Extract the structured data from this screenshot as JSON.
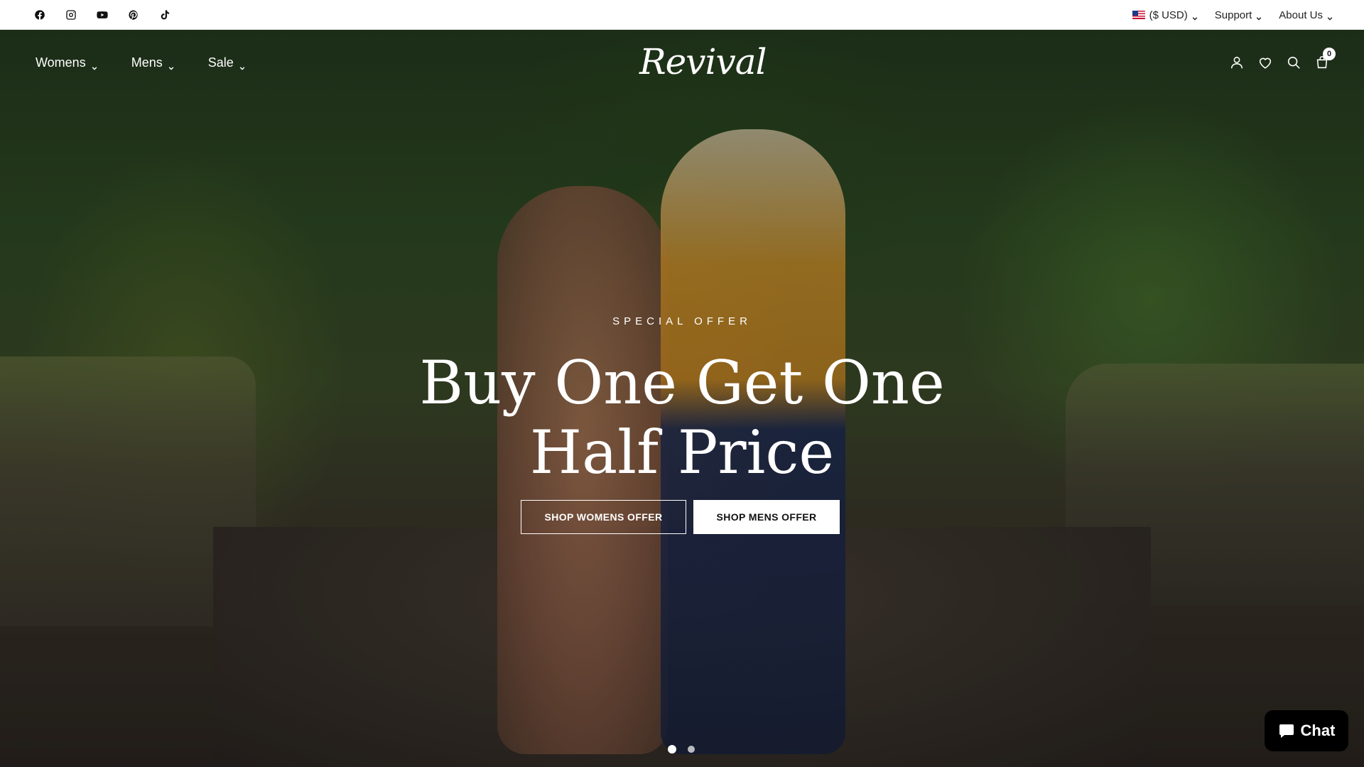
{
  "topbar": {
    "social": [
      {
        "name": "facebook-icon"
      },
      {
        "name": "instagram-icon"
      },
      {
        "name": "youtube-icon"
      },
      {
        "name": "pinterest-icon"
      },
      {
        "name": "tiktok-icon"
      }
    ],
    "currency_label": "($ USD)",
    "support_label": "Support",
    "about_label": "About Us"
  },
  "nav": {
    "items": [
      {
        "label": "Womens"
      },
      {
        "label": "Mens"
      },
      {
        "label": "Sale"
      }
    ],
    "logo_text": "Revival",
    "cart_count": "0"
  },
  "hero": {
    "eyebrow": "SPECIAL OFFER",
    "headline_line1": "Buy One Get One",
    "headline_line2": "Half Price",
    "cta_womens": "SHOP WOMENS OFFER",
    "cta_mens": "SHOP MENS OFFER",
    "slides_total": 2,
    "active_slide": 1
  },
  "chat": {
    "label": "Chat"
  },
  "colors": {
    "topbar_bg": "#ffffff",
    "text_dark": "#111111",
    "hero_text": "#ffffff",
    "chat_bg": "#000000"
  }
}
